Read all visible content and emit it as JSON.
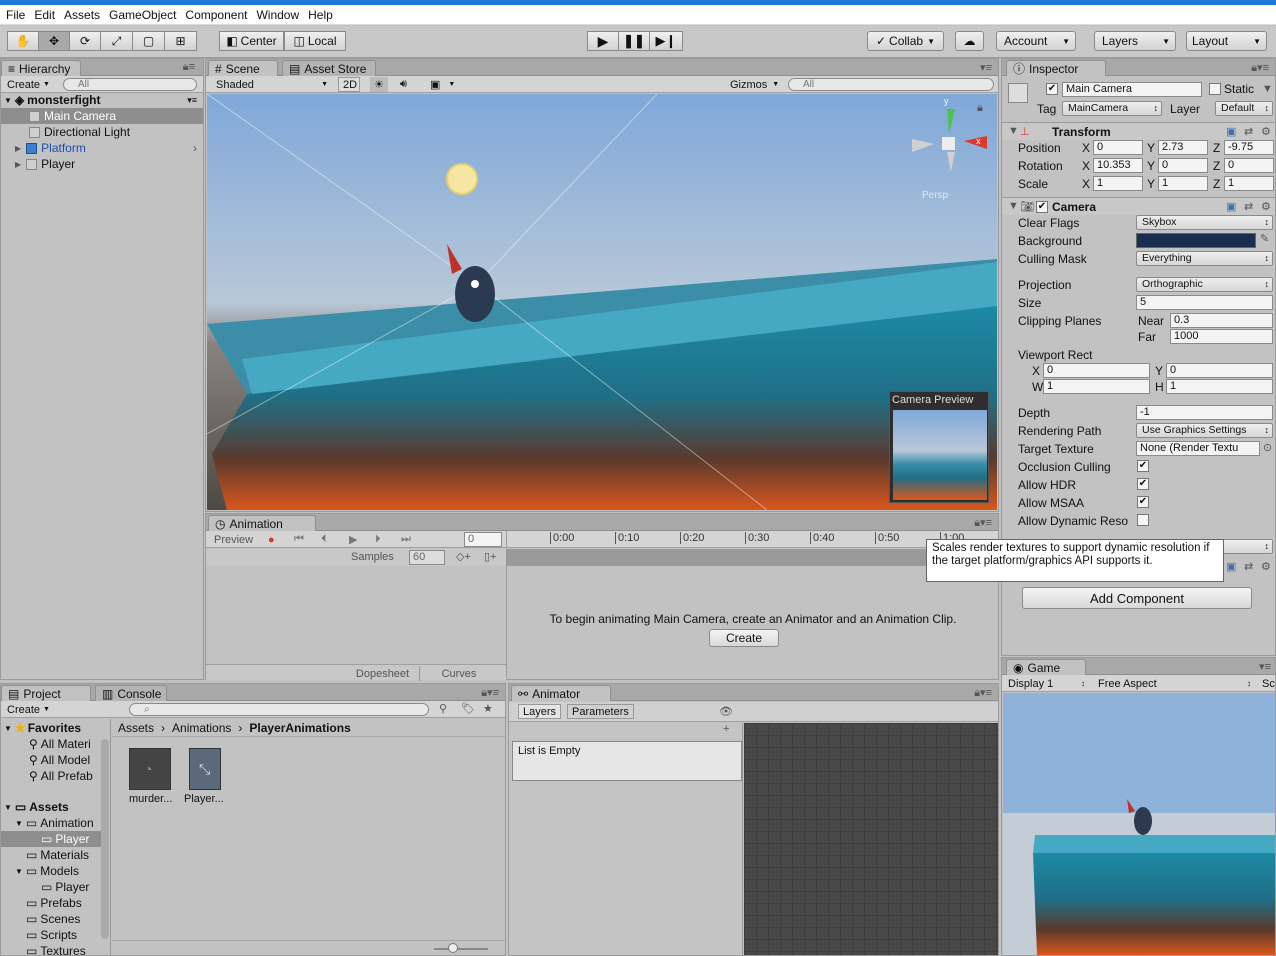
{
  "menu": [
    "File",
    "Edit",
    "Assets",
    "GameObject",
    "Component",
    "Window",
    "Help"
  ],
  "toolbar": {
    "tools": [
      "hand-icon",
      "move-icon",
      "rotate-icon",
      "scale-icon",
      "rect-icon",
      "transform-icon"
    ],
    "pivot": "Center",
    "space": "Local",
    "collab": "Collab",
    "account": "Account",
    "layers": "Layers",
    "layout": "Layout"
  },
  "hierarchy": {
    "tab": "Hierarchy",
    "create": "Create",
    "search": "All",
    "scene": "monsterfight",
    "items": [
      "Main Camera",
      "Directional Light",
      "Platform",
      "Player"
    ]
  },
  "scene": {
    "tab": "Scene",
    "tab2": "Asset Store",
    "shading": "Shaded",
    "mode2d": "2D",
    "gizmos": "Gizmos",
    "search": "All",
    "persp": "Persp",
    "camera_preview": "Camera Preview"
  },
  "animation": {
    "tab": "Animation",
    "preview": "Preview",
    "frame": "0",
    "samples_label": "Samples",
    "samples": "60",
    "ticks": [
      "0:00",
      "0:10",
      "0:20",
      "0:30",
      "0:40",
      "0:50",
      "1:00"
    ],
    "message": "To begin animating Main Camera, create an Animator and an Animation Clip.",
    "create": "Create",
    "dopesheet": "Dopesheet",
    "curves": "Curves"
  },
  "inspector": {
    "tab": "Inspector",
    "name": "Main Camera",
    "static": "Static",
    "tag_label": "Tag",
    "tag": "MainCamera",
    "layer_label": "Layer",
    "layer": "Default",
    "transform": {
      "title": "Transform",
      "position": {
        "label": "Position",
        "x": "0",
        "y": "2.73",
        "z": "-9.75"
      },
      "rotation": {
        "label": "Rotation",
        "x": "10.353",
        "y": "0",
        "z": "0"
      },
      "scale": {
        "label": "Scale",
        "x": "1",
        "y": "1",
        "z": "1"
      }
    },
    "camera": {
      "title": "Camera",
      "clear_flags_label": "Clear Flags",
      "clear_flags": "Skybox",
      "background_label": "Background",
      "background_color": "#1a2d4e",
      "culling_label": "Culling Mask",
      "culling": "Everything",
      "projection_label": "Projection",
      "projection": "Orthographic",
      "size_label": "Size",
      "size": "5",
      "clipping_label": "Clipping Planes",
      "near_label": "Near",
      "near": "0.3",
      "far_label": "Far",
      "far": "1000",
      "viewport_label": "Viewport Rect",
      "vx": "0",
      "vy": "0",
      "vw": "1",
      "vh": "1",
      "depth_label": "Depth",
      "depth": "-1",
      "rendering_label": "Rendering Path",
      "rendering": "Use Graphics Settings",
      "target_label": "Target Texture",
      "target": "None (Render Textu",
      "occlusion_label": "Occlusion Culling",
      "hdr_label": "Allow HDR",
      "msaa_label": "Allow MSAA",
      "dynres_label": "Allow Dynamic Reso"
    },
    "tooltip": "Scales render textures to support dynamic resolution if the target platform/graphics API supports it.",
    "add_component": "Add Component"
  },
  "game": {
    "tab": "Game",
    "display": "Display 1",
    "aspect": "Free Aspect",
    "scale": "Sca"
  },
  "project": {
    "tab": "Project",
    "tab2": "Console",
    "create": "Create",
    "favorites": "Favorites",
    "fav_items": [
      "All Materi",
      "All Model",
      "All Prefab"
    ],
    "assets": "Assets",
    "tree": [
      {
        "label": "Animation",
        "level": 1
      },
      {
        "label": "Player",
        "level": 2
      },
      {
        "label": "Materials",
        "level": 1
      },
      {
        "label": "Models",
        "level": 1
      },
      {
        "label": "Player",
        "level": 2
      },
      {
        "label": "Prefabs",
        "level": 1
      },
      {
        "label": "Scenes",
        "level": 1
      },
      {
        "label": "Scripts",
        "level": 1
      },
      {
        "label": "Textures",
        "level": 1
      }
    ],
    "breadcrumb": [
      "Assets",
      "Animations",
      "PlayerAnimations"
    ],
    "files": [
      "murder...",
      "Player..."
    ]
  },
  "animator": {
    "tab": "Animator",
    "layers": "Layers",
    "parameters": "Parameters",
    "empty": "List is Empty"
  }
}
